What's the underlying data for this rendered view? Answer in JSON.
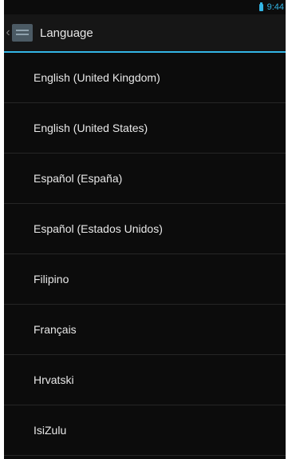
{
  "status_bar": {
    "time": "9:44"
  },
  "action_bar": {
    "title": "Language"
  },
  "languages": [
    "English (United Kingdom)",
    "English (United States)",
    "Español (España)",
    "Español (Estados Unidos)",
    "Filipino",
    "Français",
    "Hrvatski",
    "IsiZulu"
  ],
  "colors": {
    "accent": "#33b5e5",
    "background": "#0c0c0c",
    "text": "#e8e8e8"
  }
}
